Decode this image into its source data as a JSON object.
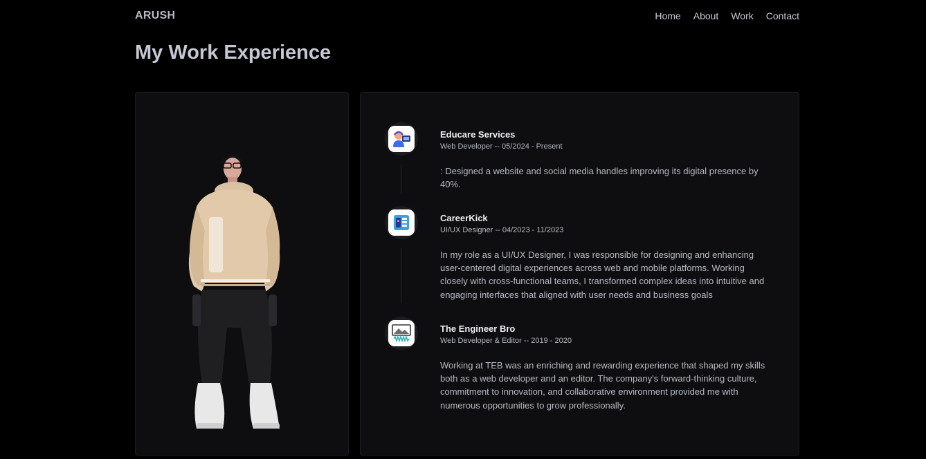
{
  "brand": "ARUSH",
  "nav": {
    "items": [
      "Home",
      "About",
      "Work",
      "Contact"
    ]
  },
  "page_title": "My Work Experience",
  "experience": [
    {
      "company": "Educare Services",
      "role": "Web Developer -- 05/2024 - Present",
      "description": ": Designed a website and social media handles improving its digital presence by 40%.",
      "icon": "support-agent-icon"
    },
    {
      "company": "CareerKick",
      "role": "UI/UX Designer -- 04/2023 - 11/2023",
      "description": "In my role as a UI/UX Designer, I was responsible for designing and enhancing user-centered digital experiences across web and mobile platforms. Working closely with cross-functional teams, I transformed complex ideas into intuitive and engaging interfaces that aligned with user needs and business goals",
      "icon": "ui-design-icon"
    },
    {
      "company": "The Engineer Bro",
      "role": "Web Developer & Editor -- 2019 - 2020",
      "description": "Working at TEB was an enriching and rewarding experience that shaped my skills both as a web developer and an editor. The company's forward-thinking culture, commitment to innovation, and collaborative environment provided me with numerous opportunities to grow professionally.",
      "icon": "video-editor-icon"
    }
  ],
  "colors": {
    "background": "#000000",
    "card": "#0e0e10",
    "heading": "#c5c7d2",
    "text": "#b9bbc3"
  }
}
